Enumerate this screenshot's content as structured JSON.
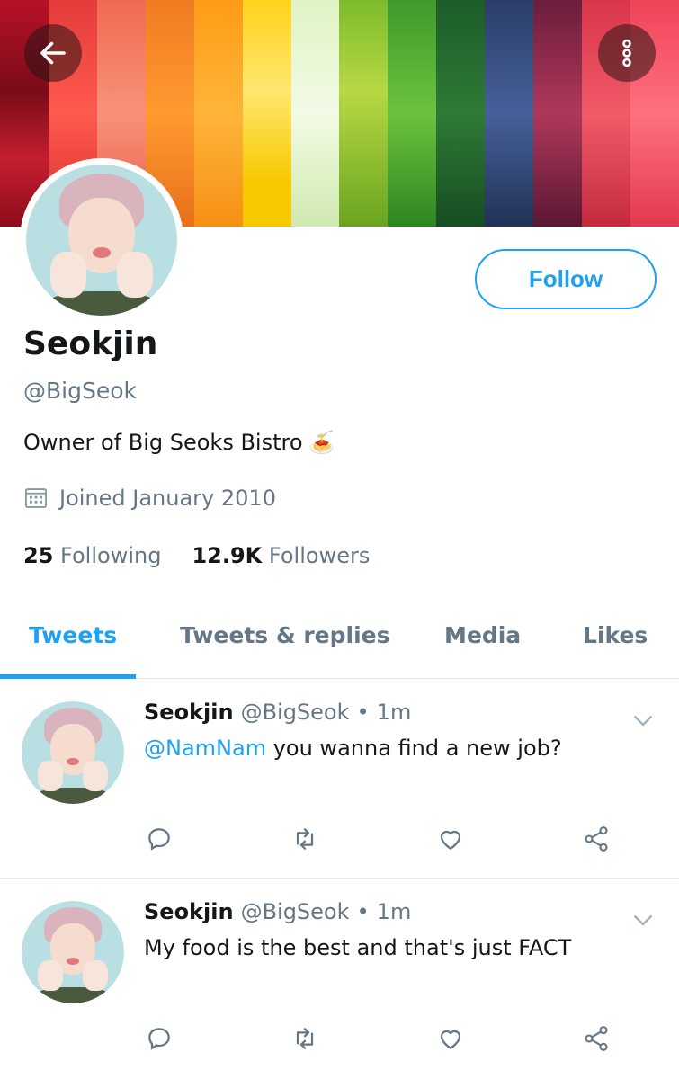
{
  "header": {
    "back_icon": "arrow-left-icon",
    "more_icon": "more-vertical-icon"
  },
  "profile": {
    "name": "Seokjin",
    "handle": "@BigSeok",
    "bio": "Owner of Big Seoks Bistro",
    "bio_emoji": "🍝",
    "joined": "Joined January 2010",
    "following_count": "25",
    "following_label": "Following",
    "followers_count": "12.9K",
    "followers_label": "Followers",
    "follow_label": "Follow"
  },
  "tabs": [
    {
      "label": "Tweets",
      "active": true
    },
    {
      "label": "Tweets & replies",
      "active": false
    },
    {
      "label": "Media",
      "active": false
    },
    {
      "label": "Likes",
      "active": false
    }
  ],
  "tweets": [
    {
      "name": "Seokjin",
      "handle": "@BigSeok",
      "dot": "•",
      "time": "1m",
      "mention": "@NamNam",
      "text": " you wanna find a new job?"
    },
    {
      "name": "Seokjin",
      "handle": "@BigSeok",
      "dot": "•",
      "time": "1m",
      "mention": "",
      "text": "My food is the best and that's just FACT"
    }
  ],
  "colors": {
    "accent": "#1da1f2",
    "muted": "#657786",
    "text": "#14171a"
  }
}
